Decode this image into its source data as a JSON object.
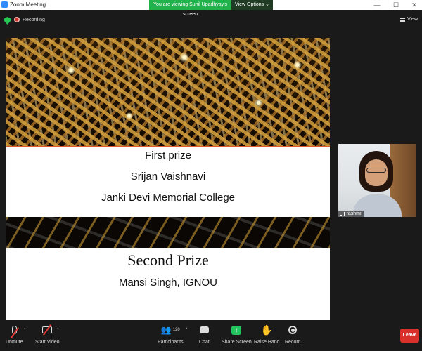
{
  "window": {
    "title": "Zoom Meeting",
    "minimize": "—",
    "maximize": "☐",
    "close": "✕"
  },
  "banner": {
    "message": "You are viewing Sunil Upadhyay's screen",
    "options_label": "View Options",
    "options_caret": "⌄"
  },
  "meeting": {
    "recording_label": "Recording",
    "view_label": "View"
  },
  "slide": {
    "first_title": "First prize",
    "first_name": "Srijan Vaishnavi",
    "first_college": "Janki Devi Memorial College",
    "second_title": "Second Prize",
    "second_name": "Mansi Singh, IGNOU"
  },
  "participant": {
    "name": "rashmi"
  },
  "toolbar": {
    "unmute_label": "Unmute",
    "start_video_label": "Start Video",
    "participants_label": "Participants",
    "participants_count": "120",
    "chat_label": "Chat",
    "share_label": "Share Screen",
    "share_glyph": "↑",
    "raise_hand_label": "Raise Hand",
    "record_label": "Record",
    "leave_label": "Leave",
    "caret": "^"
  },
  "colors": {
    "share_green": "#22c55e",
    "leave_red": "#d9302c",
    "banner_green": "#22b24c",
    "zoom_blue": "#2d8cff"
  }
}
